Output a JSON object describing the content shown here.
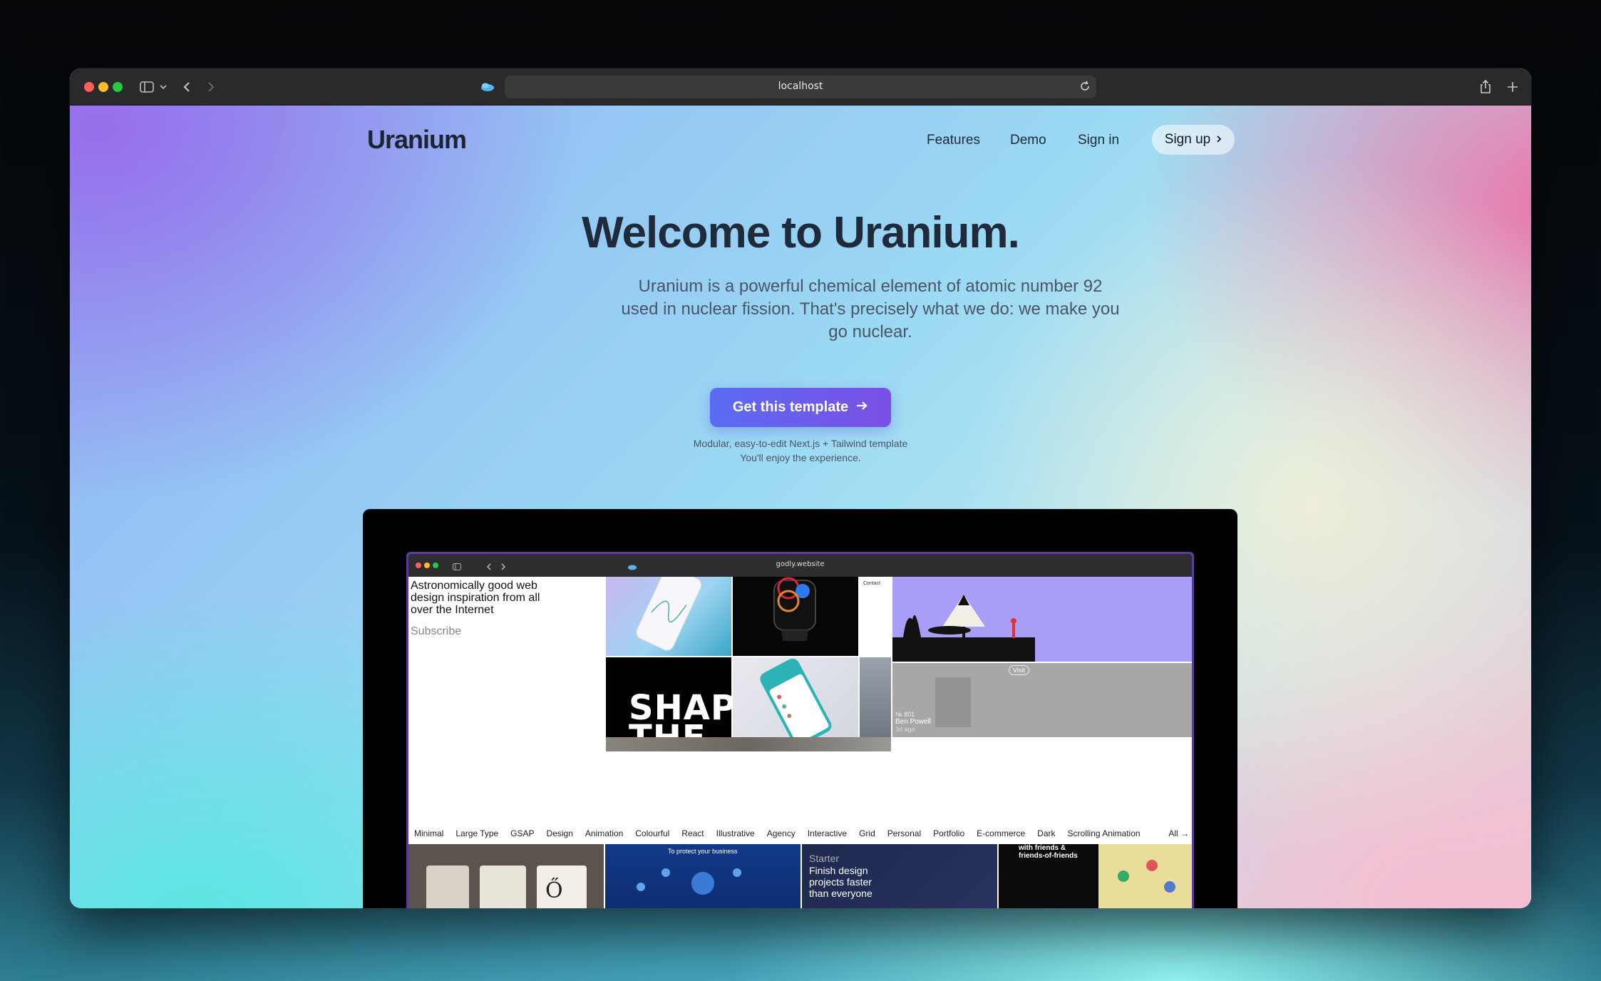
{
  "browser": {
    "url": "localhost"
  },
  "site": {
    "logo": "Uranium",
    "nav": [
      {
        "label": "Features"
      },
      {
        "label": "Demo"
      },
      {
        "label": "Sign in"
      }
    ],
    "signup_label": "Sign up"
  },
  "hero": {
    "title": "Welcome to Uranium.",
    "subtitle": "Uranium is a powerful chemical element of atomic number 92 used in nuclear fission. That's precisely what we do: we make you go nuclear.",
    "cta_label": "Get this template",
    "note_line1": "Modular, easy-to-edit Next.js + Tailwind template",
    "note_line2": "You'll enjoy the experience."
  },
  "preview": {
    "url": "godly.website",
    "tagline": "Astronomically good web design inspiration from all over the Internet",
    "subscribe": "Subscribe",
    "contact": "Contact",
    "shape_text": "SHAPE THE",
    "visit": "Visit",
    "card_number": "№ 801",
    "card_author": "Ben Powell",
    "card_age": "3d ago",
    "tags": [
      "Minimal",
      "Large Type",
      "GSAP",
      "Design",
      "Animation",
      "Colourful",
      "React",
      "Illustrative",
      "Agency",
      "Interactive",
      "Grid",
      "Personal",
      "Portfolio",
      "E-commerce",
      "Dark",
      "Scrolling Animation"
    ],
    "tags_all": "All →",
    "bottom_blue_title": "To protect your business",
    "bottom_starter": "Starter",
    "bottom_finish": "Finish design projects faster than everyone",
    "bottom_friends": "with friends & friends-of-friends"
  },
  "colors": {
    "cta_start": "#5a6cf2",
    "cta_end": "#7b4fe6",
    "title": "#1f2a3a"
  }
}
